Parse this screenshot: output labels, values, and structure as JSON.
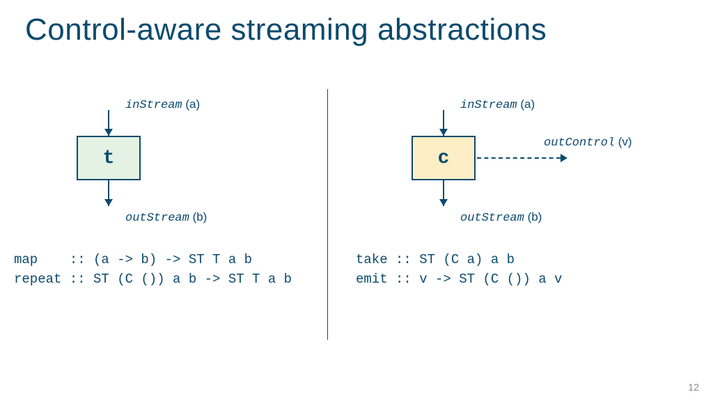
{
  "title": "Control-aware streaming abstractions",
  "left": {
    "boxLabel": "t",
    "inLabel": "inStream",
    "inType": "(a)",
    "outLabel": "outStream",
    "outType": "(b)",
    "code": "map    :: (a -> b) -> ST T a b\nrepeat :: ST (C ()) a b -> ST T a b"
  },
  "right": {
    "boxLabel": "c",
    "inLabel": "inStream",
    "inType": "(a)",
    "outLabel": "outStream",
    "outType": "(b)",
    "ctrlLabel": "outControl",
    "ctrlType": "(v)",
    "code": "take :: ST (C a) a b\nemit :: v -> ST (C ()) a v"
  },
  "pageNumber": "12"
}
